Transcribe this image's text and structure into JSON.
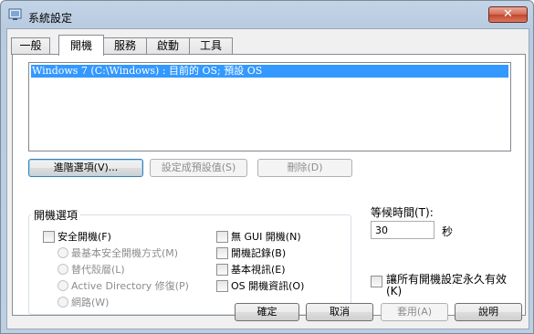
{
  "window": {
    "title": "系統設定",
    "close_label": "✕"
  },
  "tabs": [
    {
      "label": "一般",
      "active": false
    },
    {
      "label": "開機",
      "active": true
    },
    {
      "label": "服務",
      "active": false
    },
    {
      "label": "啟動",
      "active": false
    },
    {
      "label": "工具",
      "active": false
    }
  ],
  "boot": {
    "os_entries": [
      "Windows 7 (C:\\Windows) : 目前的 OS; 預設 OS"
    ],
    "buttons": {
      "advanced": "進階選項(V)...",
      "set_default": "設定成預設值(S)",
      "delete": "刪除(D)"
    },
    "options_group": {
      "title": "開機選項",
      "safe_boot": "安全開機(F)",
      "radios": [
        "最基本安全開機方式(M)",
        "替代殼層(L)",
        "Active Directory 修復(P)",
        "網路(W)"
      ],
      "checks": [
        "無 GUI 開機(N)",
        "開機記錄(B)",
        "基本視訊(E)",
        "OS 開機資訊(O)"
      ]
    },
    "timeout": {
      "label": "等候時間(T):",
      "value": "30",
      "unit": "秒"
    },
    "persist_label": "讓所有開機設定永久有效(K)"
  },
  "footer": {
    "ok": "確定",
    "cancel": "取消",
    "apply": "套用(A)",
    "help": "說明"
  }
}
